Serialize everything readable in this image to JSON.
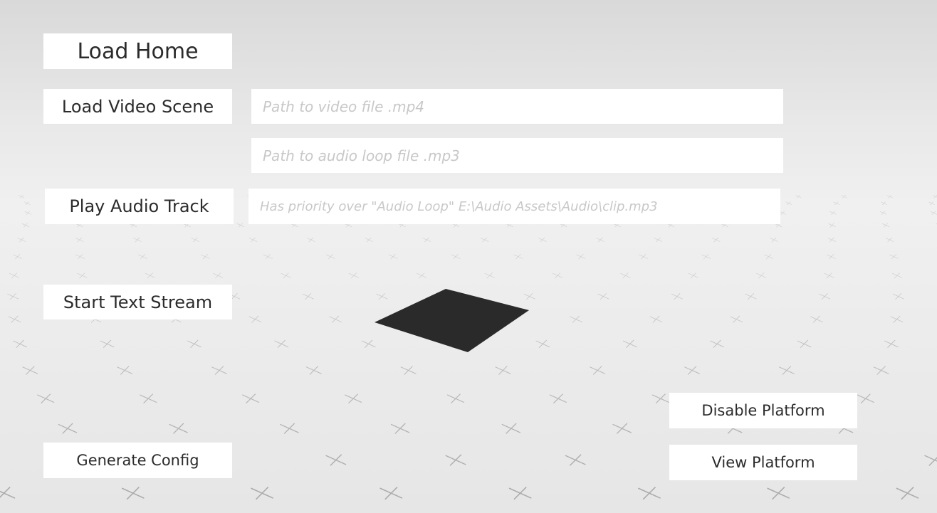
{
  "buttons": {
    "load_home": "Load Home",
    "load_video_scene": "Load Video Scene",
    "play_audio_track": "Play Audio Track",
    "start_text_stream": "Start Text Stream",
    "generate_config": "Generate Config",
    "disable_platform": "Disable Platform",
    "view_platform": "View Platform"
  },
  "inputs": {
    "video_path": {
      "value": "",
      "placeholder": "Path to video file .mp4"
    },
    "audio_loop_path": {
      "value": "",
      "placeholder": "Path to audio loop file .mp3"
    },
    "audio_track_path": {
      "value": "",
      "placeholder": "Has priority over \"Audio Loop\" E:\\Audio Assets\\Audio\\clip.mp3"
    }
  },
  "scene": {
    "floor_color": "#eaeaea",
    "sky_color": "#d8d8d8",
    "grid_mark_color": "#a0a0a0",
    "platform_color": "#2a2a2a",
    "marker_icon": "cross-mark"
  }
}
